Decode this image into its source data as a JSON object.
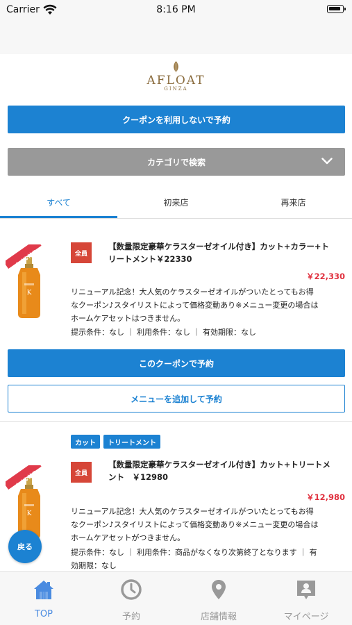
{
  "status_bar": {
    "carrier": "Carrier",
    "time": "8:16 PM"
  },
  "logo": {
    "main": "AFLOAT",
    "sub": "GINZA"
  },
  "buttons": {
    "reserve_without_coupon": "クーポンを利用しないで予約",
    "search_by_category": "カテゴリで検索"
  },
  "tabs": [
    {
      "label": "すべて",
      "active": true
    },
    {
      "label": "初来店",
      "active": false
    },
    {
      "label": "再来店",
      "active": false
    }
  ],
  "coupons": [
    {
      "badge": "全員",
      "image_label": "オイル付き",
      "tags": [],
      "title_line1": "【数量限定豪華ケラスターゼオイル付き】カット+カラー+ト",
      "title_line2": "リートメント￥22330",
      "price": "￥22,330",
      "desc_line1": "リニューアル記念！大人気のケラスターゼオイルがついたとってもお得",
      "desc_line2": "なクーポン♪スタイリストによって価格変動あり※メニュー変更の場合は",
      "desc_line3": "ホームケアセットはつきません。",
      "cond_line1": "提示条件：なし ｜ 利用条件：なし ｜ 有効期限：なし",
      "cond_line2": "",
      "reserve_label": "このクーポンで予約",
      "add_menu_label": "メニューを追加して予約"
    },
    {
      "badge": "全員",
      "image_label": "オイル付き",
      "tags": [
        "カット",
        "トリートメント"
      ],
      "title_line1": "【数量限定豪華ケラスターゼオイル付き】カット+トリートメ",
      "title_line2": "ント　￥12980",
      "price": "￥12,980",
      "desc_line1": "リニューアル記念！大人気のケラスターゼオイルがついたとってもお得",
      "desc_line2": "なクーポン♪スタイリストによって価格変動あり※メニュー変更の場合は",
      "desc_line3": "ホームケアセットがつきません。",
      "cond_line1": "提示条件：なし ｜ 利用条件：商品がなくなり次第終了となります ｜ 有",
      "cond_line2": "効期限：なし"
    }
  ],
  "back_button": "戻る",
  "tabbar": [
    {
      "label": "TOP",
      "icon": "home-icon",
      "active": true
    },
    {
      "label": "予約",
      "icon": "clock-icon",
      "active": false
    },
    {
      "label": "店舗情報",
      "icon": "location-pin-icon",
      "active": false
    },
    {
      "label": "マイページ",
      "icon": "profile-card-icon",
      "active": false
    }
  ],
  "colors": {
    "accent": "#1c82d2",
    "badge": "#d64638",
    "price": "#e0303e",
    "category_button": "#999999",
    "tabbar_active": "#4a8be0"
  }
}
